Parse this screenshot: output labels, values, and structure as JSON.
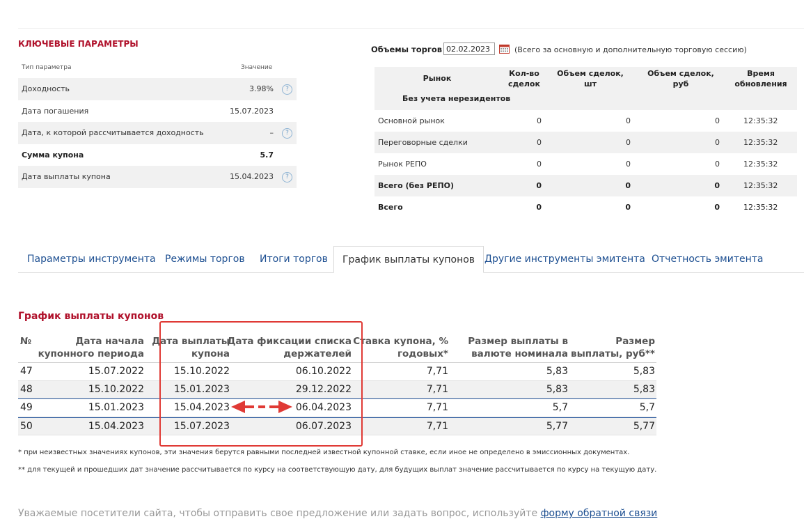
{
  "key_params": {
    "title": "КЛЮЧЕВЫЕ ПАРАМЕТРЫ",
    "col_param": "Тип параметра",
    "col_value": "Значение",
    "rows": [
      {
        "label": "Доходность",
        "value": "3.98%",
        "help": "?"
      },
      {
        "label": "Дата погашения",
        "value": "15.07.2023",
        "help": ""
      },
      {
        "label": "Дата, к которой рассчитывается доходность",
        "value": "–",
        "help": "?"
      },
      {
        "label": "Сумма купона",
        "value": "5.7",
        "help": ""
      },
      {
        "label": "Дата выплаты купона",
        "value": "15.04.2023",
        "help": "?"
      }
    ]
  },
  "volumes": {
    "title": "Объемы торгов",
    "date": "02.02.2023",
    "note": "(Всего за основную и дополнительную торговую сессию)",
    "headers": {
      "market": "Рынок",
      "count": "Кол-во сделок",
      "vol_pcs": "Объем сделок, шт",
      "vol_rub": "Объем сделок, руб",
      "time": "Время обновления",
      "sub": "Без учета нерезидентов"
    },
    "rows": [
      {
        "market": "Основной рынок",
        "count": "0",
        "vol_pcs": "0",
        "vol_rub": "0",
        "time": "12:35:32"
      },
      {
        "market": "Переговорные сделки",
        "count": "0",
        "vol_pcs": "0",
        "vol_rub": "0",
        "time": "12:35:32"
      },
      {
        "market": "Рынок РЕПО",
        "count": "0",
        "vol_pcs": "0",
        "vol_rub": "0",
        "time": "12:35:32"
      },
      {
        "market": "Всего (без РЕПО)",
        "count": "0",
        "vol_pcs": "0",
        "vol_rub": "0",
        "time": "12:35:32"
      },
      {
        "market": "Всего",
        "count": "0",
        "vol_pcs": "0",
        "vol_rub": "0",
        "time": "12:35:32"
      }
    ]
  },
  "tabs": [
    "Параметры инструмента",
    "Режимы торгов",
    "Итоги торгов",
    "График выплаты купонов",
    "Другие инструменты эмитента",
    "Отчетность эмитента"
  ],
  "coupons": {
    "title": "График выплаты купонов",
    "headers": {
      "num": "№",
      "start_1": "Дата начала",
      "start_2": "купонного периода",
      "pay_1": "Дата выплаты",
      "pay_2": "купона",
      "fix_1": "Дата фиксации списка",
      "fix_2": "держателей",
      "rate_1": "Ставка купона, %",
      "rate_2": "годовых*",
      "nom_1": "Размер выплаты в",
      "nom_2": "валюте номинала",
      "rub_1": "Размер",
      "rub_2": "выплаты, руб**"
    },
    "rows": [
      {
        "num": "47",
        "start": "15.07.2022",
        "pay": "15.10.2022",
        "fix": "06.10.2022",
        "rate": "7,71",
        "nom": "5,83",
        "rub": "5,83"
      },
      {
        "num": "48",
        "start": "15.10.2022",
        "pay": "15.01.2023",
        "fix": "29.12.2022",
        "rate": "7,71",
        "nom": "5,83",
        "rub": "5,83"
      },
      {
        "num": "49",
        "start": "15.01.2023",
        "pay": "15.04.2023",
        "fix": "06.04.2023",
        "rate": "7,71",
        "nom": "5,7",
        "rub": "5,7"
      },
      {
        "num": "50",
        "start": "15.04.2023",
        "pay": "15.07.2023",
        "fix": "06.07.2023",
        "rate": "7,71",
        "nom": "5,77",
        "rub": "5,77"
      }
    ],
    "note1": "* при неизвестных значениях купонов, эти значения берутся равными последней известной купонной ставке, если иное не определено в эмиссионных документах.",
    "note2": "** для текущей и прошедших дат значение рассчитывается по курсу на соответствующую дату, для будущих выплат значение рассчитывается по курсу на текущую дату."
  },
  "footer": {
    "text": "Уважаемые посетители сайта, чтобы отправить свое предложение или задать вопрос, используйте ",
    "link": "форму обратной связи"
  },
  "colors": {
    "accent_red": "#b0112b",
    "link_blue": "#1d4f91",
    "annotation_red": "#e03a35"
  }
}
